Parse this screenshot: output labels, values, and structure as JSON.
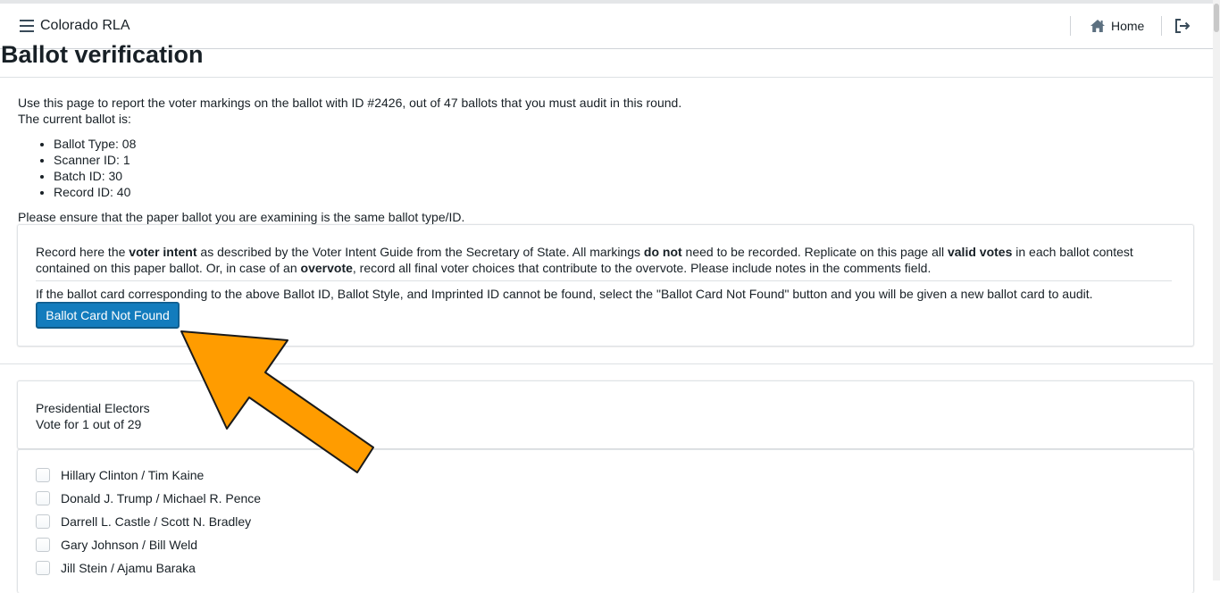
{
  "app": {
    "title": "Colorado RLA"
  },
  "nav": {
    "home_label": "Home"
  },
  "page": {
    "title": "Ballot verification"
  },
  "intro": {
    "line1": "Use this page to report the voter markings on the ballot with ID #2426, out of 47 ballots that you must audit in this round.",
    "line2": "The current ballot is:",
    "details": [
      "Ballot Type: 08",
      "Scanner ID: 1",
      "Batch ID: 30",
      "Record ID: 40"
    ],
    "ensure": "Please ensure that the paper ballot you are examining is the same ballot type/ID."
  },
  "instructions": {
    "p1_a": "Record here the ",
    "p1_b": "voter intent",
    "p1_c": " as described by the Voter Intent Guide from the Secretary of State. All markings ",
    "p1_d": "do not",
    "p1_e": " need to be recorded. Replicate on this page all ",
    "p1_f": "valid votes",
    "p1_g": " in each ballot contest contained on this paper ballot. Or, in case of an ",
    "p1_h": "overvote",
    "p1_i": ", record all final voter choices that contribute to the overvote. Please include notes in the comments field.",
    "p2": "If the ballot card corresponding to the above Ballot ID, Ballot Style, and Imprinted ID cannot be found, select the \"Ballot Card Not Found\" button and you will be given a new ballot card to audit.",
    "not_found_button": "Ballot Card Not Found"
  },
  "contest": {
    "name": "Presidential Electors",
    "rule": "Vote for 1 out of 29",
    "choices": [
      {
        "label": "Hillary Clinton / Tim Kaine",
        "checked": false
      },
      {
        "label": "Donald J. Trump / Michael R. Pence",
        "checked": false
      },
      {
        "label": "Darrell L. Castle / Scott N. Bradley",
        "checked": false
      },
      {
        "label": "Gary Johnson / Bill Weld",
        "checked": false
      },
      {
        "label": "Jill Stein / Ajamu Baraka",
        "checked": false
      }
    ]
  },
  "icons": {
    "menu": "menu-icon",
    "home": "home-icon",
    "logout": "log-out-icon",
    "annotation": "pointer-arrow-icon"
  },
  "colors": {
    "primary_button": "#137cbd",
    "annotation_arrow": "#ff9c00"
  }
}
